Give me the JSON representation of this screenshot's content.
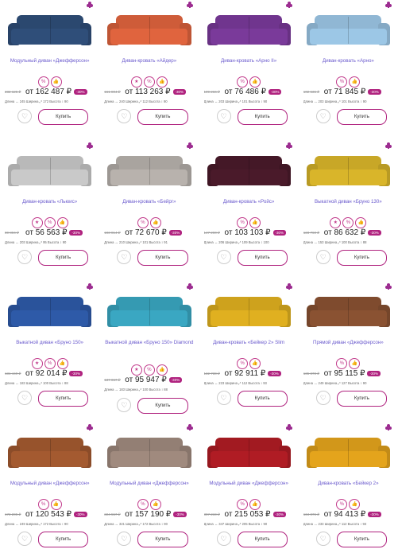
{
  "labels": {
    "buy": "Купить",
    "currency": "₽",
    "from": "от",
    "discount": "-30%"
  },
  "icons": {
    "badge_a": "%",
    "badge_b": "★",
    "badge_c": "👍",
    "heart": "♡"
  },
  "products": [
    {
      "title": "Модульный диван «Джефферсон»",
      "old": "232 125 ₽",
      "price": "от 162 487 ₽",
      "specs": "Длина ↔ 245  Ширина ⤢ 172  Высота ↕ 90",
      "color": "#2f4e79",
      "badges": 2
    },
    {
      "title": "Диван-кровать «Айдер»",
      "old": "161 804 ₽",
      "price": "от 113 263 ₽",
      "specs": "Длина ↔ 240  Ширина ⤢ 112  Высота ↕ 90",
      "color": "#e0643e",
      "badges": 3
    },
    {
      "title": "Диван-кровать «Арно II»",
      "old": "109 266 ₽",
      "price": "от 76 486 ₽",
      "specs": "Длина ↔ 203  Ширина ⤢ 101  Высота ↕ 90",
      "color": "#7a3a9a",
      "badges": 2
    },
    {
      "title": "Диван-кровать «Арно»",
      "old": "102 636 ₽",
      "price": "от 71 845 ₽",
      "specs": "Длина ↔ 203  Ширина ⤢ 101  Высота ↕ 90",
      "color": "#9cc7e6",
      "badges": 2
    },
    {
      "title": "Диван-кровать «Льюис»",
      "old": "80 804 ₽",
      "price": "от 56 563 ₽",
      "specs": "Длина ↔ 203  Ширина ⤢ 95  Высота ↕ 90",
      "color": "#c9c9c9",
      "badges": 3
    },
    {
      "title": "Диван-кровать «Бейрг»",
      "old": "103 814 ₽",
      "price": "от 72 670 ₽",
      "specs": "Длина ↔ 210  Ширина ⤢ 101  Высота ↕ 91",
      "color": "#b8b2ad",
      "badges": 2
    },
    {
      "title": "Диван-кровать «Ройс»",
      "old": "147 290 ₽",
      "price": "от 103 103 ₽",
      "specs": "Длина ↔ 206  Ширина ⤢ 109  Высота ↕ 100",
      "color": "#4a1a2a",
      "badges": 2
    },
    {
      "title": "Выкатной диван «Бруно 130»",
      "old": "123 760 ₽",
      "price": "от 86 632 ₽",
      "specs": "Длина ↔ 153  Ширина ⤢ 100  Высота ↕ 88",
      "color": "#d9b52a",
      "badges": 3
    },
    {
      "title": "Выкатной диван «Бруно 150»",
      "old": "131 449 ₽",
      "price": "от 92 014 ₽",
      "specs": "Длина ↔ 183  Ширина ⤢ 100  Высота ↕ 88",
      "color": "#2e5aa8",
      "badges": 3
    },
    {
      "title": "Выкатной диван «Бруно 150» Diamond",
      "old": "137 067 ₽",
      "price": "от 95 947 ₽",
      "specs": "Длина ↔ 183  Ширина ⤢ 100  Высота ↕ 88",
      "color": "#3aa7c2",
      "badges": 3
    },
    {
      "title": "Диван-кровать «Бейкер 2» Slim",
      "old": "132 730 ₽",
      "price": "от 92 911 ₽",
      "specs": "Длина ↔ 223  Ширина ⤢ 112  Высота ↕ 93",
      "color": "#e0b020",
      "badges": 2
    },
    {
      "title": "Прямой диван «Джефферсон»",
      "old": "135 878 ₽",
      "price": "от 95 115 ₽",
      "specs": "Длина ↔ 249  Ширина ⤢ 127  Высота ↕ 90",
      "color": "#8a5232",
      "badges": 2
    },
    {
      "title": "Модульный диван «Джефферсон»",
      "old": "172 205 ₽",
      "price": "от 120 543 ₽",
      "specs": "Длина ↔ 249  Ширина ⤢ 172  Высота ↕ 90",
      "color": "#a45a30",
      "badges": 2
    },
    {
      "title": "Модульный диван «Джефферсон»",
      "old": "224 557 ₽",
      "price": "от 157 190 ₽",
      "specs": "Длина ↔ 321  Ширина ⤢ 172  Высота ↕ 90",
      "color": "#a08a7e",
      "badges": 2
    },
    {
      "title": "Модульный диван «Джефферсон»",
      "old": "307 219 ₽",
      "price": "от 215 053 ₽",
      "specs": "Длина ↔ 347  Ширина ⤢ 205  Высота ↕ 90",
      "color": "#b01c24",
      "badges": 2
    },
    {
      "title": "Диван-кровать «Бейкер 2»",
      "old": "134 876 ₽",
      "price": "от 94 413 ₽",
      "specs": "Длина ↔ 233  Ширина ⤢ 112  Высота ↕ 93",
      "color": "#e4a41c",
      "badges": 2
    }
  ]
}
